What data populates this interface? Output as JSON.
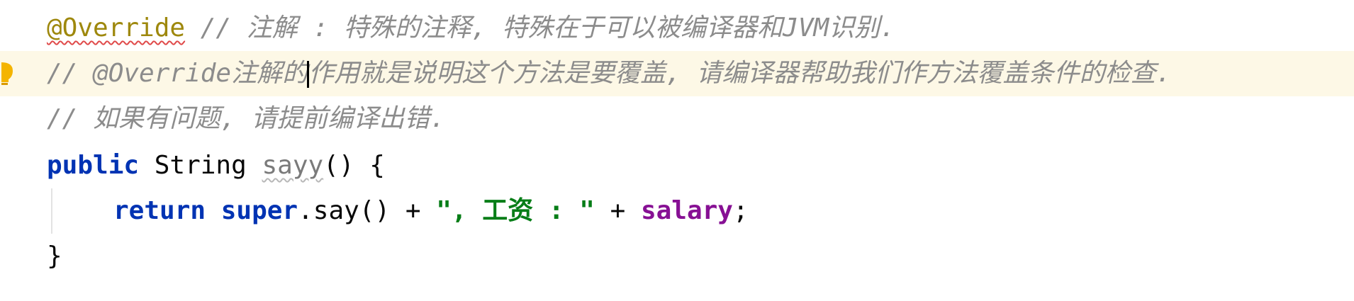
{
  "editor": {
    "lines": [
      {
        "annotation": "@Override",
        "comment": " // 注解 : 特殊的注释, 特殊在于可以被编译器和JVM识别."
      },
      {
        "comment_before_caret": "// @Override注解的",
        "comment_after_caret": "作用就是说明这个方法是要覆盖, 请编译器帮助我们作方法覆盖条件的检查."
      },
      {
        "comment": "// 如果有问题, 请提前编译出错."
      },
      {
        "kw_public": "public",
        "type_string": "String",
        "method_name": "sayy",
        "signature_tail": "() {"
      },
      {
        "kw_return": "return",
        "kw_super": "super",
        "call": ".say() + ",
        "string_literal": "\", 工资 : \"",
        "plus": " + ",
        "field": "salary",
        "semicolon": ";"
      },
      {
        "closing_brace": "}"
      }
    ],
    "gutter_icon": "lightbulb-icon",
    "colors": {
      "annotation": "#9e880d",
      "comment": "#8c8c8c",
      "keyword": "#0033b3",
      "string": "#067d17",
      "field": "#871094",
      "current_line_bg": "#fdf8e6",
      "bulb": "#f4b400"
    }
  }
}
